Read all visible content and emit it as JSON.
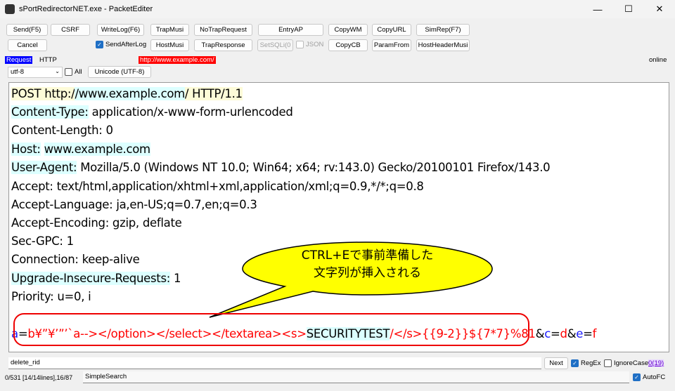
{
  "window": {
    "title": "sPortRedirectorNET.exe - PacketEditer",
    "minimize": "—",
    "maximize": "☐",
    "close": "✕"
  },
  "toolbar": {
    "row1": [
      "Send(F5)",
      "CSRF",
      "WriteLog(F6)",
      "TrapMusi",
      "NoTrapRequest",
      "EntryAP",
      "CopyWM",
      "CopyURL",
      "SimRep(F7)"
    ],
    "row2": [
      "Cancel",
      "HostMusi",
      "TrapResponse",
      "SetSQLi(0",
      "CopyCB",
      "ParamFrom",
      "HostHeaderMusi"
    ],
    "send_after_log": "SendAfterLog",
    "json": "JSON"
  },
  "info": {
    "request": "Request",
    "protocol": "HTTP",
    "url": "http://www.example.com/",
    "status": "online"
  },
  "encoding": {
    "selected": "utf-8",
    "all": "All",
    "unicode_button": "Unicode (UTF-8)"
  },
  "request_lines": {
    "l1a": "POST http:/",
    "l1b": "/www.example.com",
    "l1c": "/ HTTP/1.1",
    "ct_name": "Content-Type:",
    "ct_val": " application/x-www-form-urlencoded",
    "cl": "Content-Length: 0",
    "host_name": "Host:",
    "host_val": "www.example.com",
    "ua_name": "User-Agent:",
    "ua_val": " Mozilla/5.0 (Windows NT 10.0; Win64; x64; rv:143.0) Gecko/20100101 Firefox/143.0",
    "accept": "Accept: text/html,application/xhtml+xml,application/xml;q=0.9,*/*;q=0.8",
    "accept_lang": "Accept-Language: ja,en-US;q=0.7,en;q=0.3",
    "accept_enc": "Accept-Encoding: gzip, deflate",
    "sec_gpc": "Sec-GPC: 1",
    "connection": "Connection: keep-alive",
    "uir_name": "Upgrade-Insecure-Requests:",
    "uir_val": " 1",
    "priority": "Priority: u=0, i"
  },
  "body": {
    "k1": "a",
    "eq": "=",
    "v1a": "b¥”¥’”’`a--></option></select></textarea><s>",
    "v1b": "SECURITYTEST",
    "v1c": "/</s>{{9-2}}${7*7}%81",
    "amp": "&",
    "k2": "c",
    "v2": "d",
    "k3": "e",
    "v3": "f"
  },
  "callout": {
    "line1": "CTRL+Eで事前準備した",
    "line2": "文字列が挿入される"
  },
  "search": {
    "value": "delete_rid",
    "next": "Next",
    "regex": "RegEx",
    "ignore_case": "IgnoreCase",
    "count": "0(19)"
  },
  "statusbar": {
    "position": "0/531 [14/14lines],16/87",
    "mode": "SimpleSearch",
    "autofc": "AutoFC"
  },
  "colors": {
    "accent": "#1f6fc5",
    "request_bg": "#0000ff",
    "url_bg": "#ff0000",
    "callout": "#ffff00"
  }
}
